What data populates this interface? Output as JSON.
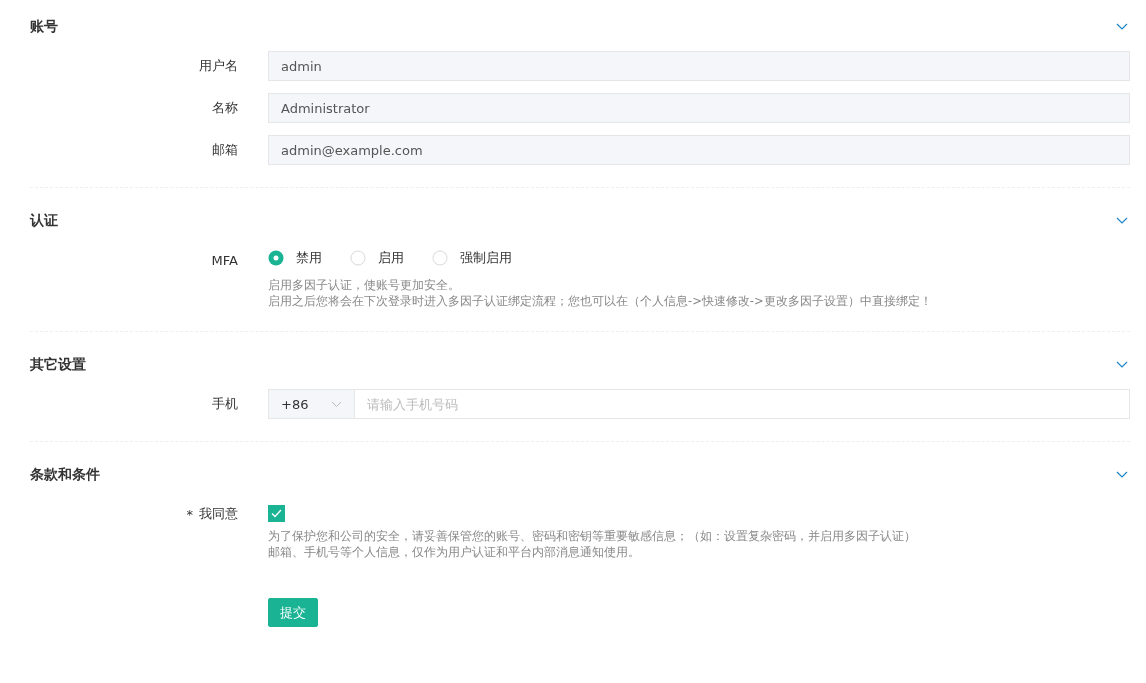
{
  "sections": [
    {
      "title": "账号",
      "expanded": true,
      "rows": [
        {
          "kind": "text",
          "label": "用户名",
          "value": "admin",
          "disabled": true
        },
        {
          "kind": "text",
          "label": "名称",
          "value": "Administrator",
          "disabled": true
        },
        {
          "kind": "text",
          "label": "邮箱",
          "value": "admin@example.com",
          "disabled": true
        }
      ]
    },
    {
      "title": "认证",
      "expanded": true,
      "rows": [
        {
          "kind": "radio",
          "label": "MFA",
          "options": [
            {
              "label": "禁用",
              "selected": true
            },
            {
              "label": "启用",
              "selected": false
            },
            {
              "label": "强制启用",
              "selected": false
            }
          ],
          "help": [
            "启用多因子认证，使账号更加安全。",
            "启用之后您将会在下次登录时进入多因子认证绑定流程；您也可以在（个人信息->快速修改->更改多因子设置）中直接绑定！"
          ]
        }
      ]
    },
    {
      "title": "其它设置",
      "expanded": true,
      "rows": [
        {
          "kind": "phone",
          "label": "手机",
          "code": "+86",
          "placeholder": "请输入手机号码"
        }
      ]
    },
    {
      "title": "条款和条件",
      "expanded": true,
      "rows": [
        {
          "kind": "checkbox",
          "label": "我同意",
          "required_mark": "*",
          "checked": true,
          "help": [
            "为了保护您和公司的安全，请妥善保管您的账号、密码和密钥等重要敏感信息；（如：设置复杂密码，并启用多因子认证）",
            "邮箱、手机号等个人信息，仅作为用户认证和平台内部消息通知使用。"
          ]
        }
      ]
    }
  ],
  "submit": "提交"
}
